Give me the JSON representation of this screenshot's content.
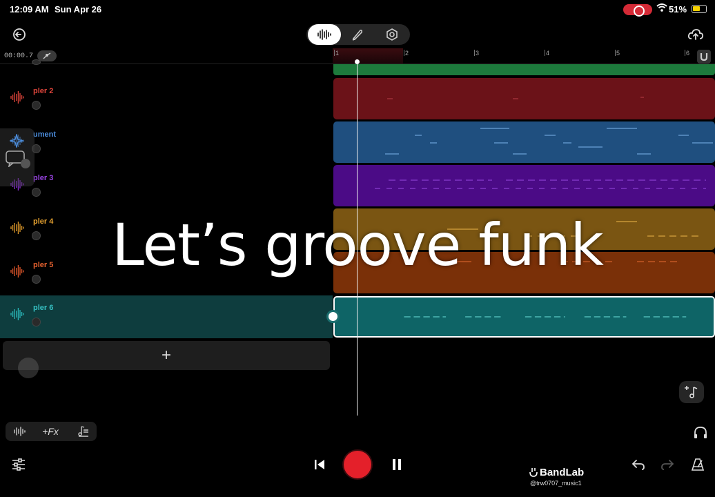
{
  "status_bar": {
    "time": "12:09 AM",
    "date": "Sun Apr 26",
    "battery": "51%"
  },
  "toolbar": {
    "modes": [
      {
        "icon": "waveform-icon",
        "active": true
      },
      {
        "icon": "pen-icon",
        "active": false
      },
      {
        "icon": "hexagon-settings-icon",
        "active": false
      }
    ]
  },
  "timeline": {
    "timecode": "00:00.7",
    "ruler_ticks": [
      "1",
      "2",
      "3",
      "4",
      "5",
      "6"
    ]
  },
  "tracks": [
    {
      "name": "",
      "color": "#1d7a3c",
      "selected": false
    },
    {
      "name": "pler 2",
      "color": "#6b1218",
      "wave_color": "#e0453b",
      "name_color": "#e0453b",
      "selected": false
    },
    {
      "name": "ument",
      "color": "#1f4f7f",
      "wave_color": "#3a78c4",
      "name_color": "#4c8fe0",
      "selected": false
    },
    {
      "name": "pler 3",
      "color": "#4b0b86",
      "wave_color": "#8b2fd6",
      "name_color": "#9b44e6",
      "selected": false
    },
    {
      "name": "pler 4",
      "color": "#7a5512",
      "wave_color": "#e09a2a",
      "name_color": "#e8a330",
      "selected": false
    },
    {
      "name": "pler 5",
      "color": "#7a3008",
      "wave_color": "#e0562a",
      "name_color": "#e8622f",
      "selected": false
    },
    {
      "name": "pler 6",
      "color": "#0e6466",
      "wave_color": "#29b6b8",
      "name_color": "#36c0c2",
      "selected": true
    }
  ],
  "overlay_caption": "Let’s groove funk",
  "add_track_label": "+",
  "bottom_tools": {
    "fx_label": "+Fx"
  },
  "transport": {
    "record_color": "#e4202a"
  },
  "watermark": {
    "brand": "BandLab",
    "handle": "@trw0707_music1"
  }
}
